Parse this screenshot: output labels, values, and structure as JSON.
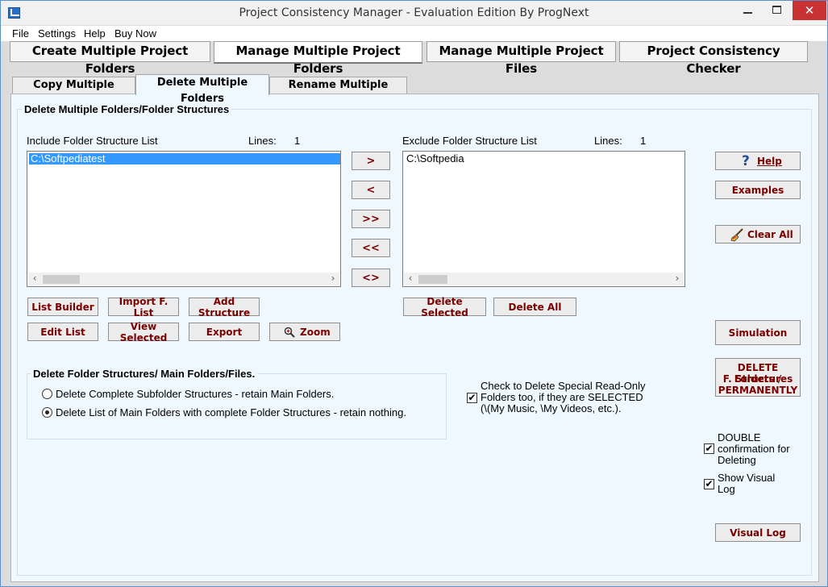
{
  "window": {
    "title": "Project Consistency Manager - Evaluation Edition  By ProgNext",
    "close_glyph": "✕"
  },
  "menu": [
    "File",
    "Settings",
    "Help",
    "Buy Now"
  ],
  "main_tabs": [
    "Create Multiple Project Folders",
    "Manage Multiple Project Folders",
    "Manage Multiple Project Files",
    "Project Consistency Checker"
  ],
  "sub_tabs": [
    "Copy Multiple Folders",
    "Delete Multiple Folders",
    "Rename Multiple Folders"
  ],
  "group_title": "Delete Multiple Folders/Folder Structures",
  "include": {
    "label": "Include Folder Structure List",
    "lines_label": "Lines:",
    "lines_count": "1",
    "items": [
      "C:\\Softpediatest"
    ]
  },
  "exclude": {
    "label": "Exclude Folder Structure List",
    "lines_label": "Lines:",
    "lines_count": "1",
    "items": [
      "C:\\Softpedia"
    ]
  },
  "move_buttons": [
    ">",
    "<",
    ">>",
    "<<",
    "<>"
  ],
  "scroll": {
    "left": "‹",
    "right": "›"
  },
  "include_buttons": {
    "list_builder": "List Builder",
    "import_list": "Import F. List",
    "add_structure": "Add Structure",
    "edit_list": "Edit List",
    "view_selected": "View Selected",
    "export": "Export",
    "zoom": "Zoom"
  },
  "exclude_buttons": {
    "delete_selected": "Delete Selected",
    "delete_all": "Delete All"
  },
  "side_buttons": {
    "help": "Help",
    "examples": "Examples",
    "clear_all": "Clear All",
    "simulation": "Simulation",
    "delete_perm": [
      "DELETE Folders /",
      "F. Structures",
      "PERMANENTLY"
    ],
    "visual_log": "Visual Log"
  },
  "delete_mode": {
    "title": "Delete Folder Structures/ Main Folders/Files.",
    "options": [
      "Delete Complete Subfolder Structures - retain Main Folders.",
      "Delete List of Main Folders with complete Folder Structures - retain nothing."
    ],
    "selected_index": 1
  },
  "special_readonly": {
    "checked": true,
    "lines": [
      "Check to  Delete Special Read-Only",
      "Folders too, if they are SELECTED",
      "(\\(My Music, \\My Videos, etc.)."
    ]
  },
  "double_confirm": {
    "checked": true,
    "lines": [
      "DOUBLE",
      "confirmation for",
      "Deleting"
    ]
  },
  "show_visual_log": {
    "checked": true,
    "lines": [
      "Show Visual",
      "Log"
    ]
  },
  "icons": {
    "help": "question-icon",
    "clear": "broom-icon",
    "zoom": "magnifier-icon",
    "check": "✔"
  },
  "colors": {
    "button_text": "#7b0000",
    "panel_bg": "#f0f8ff",
    "selection": "#3399ff"
  }
}
